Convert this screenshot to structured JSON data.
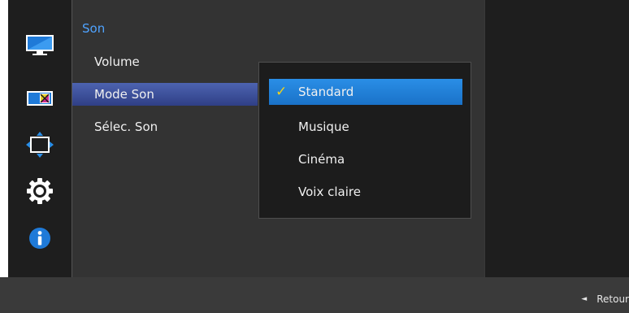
{
  "menu": {
    "title": "Son",
    "items": [
      {
        "label": "Volume",
        "selected": false
      },
      {
        "label": "Mode Son",
        "selected": true
      },
      {
        "label": "Sélec. Son",
        "selected": false
      }
    ]
  },
  "submenu": {
    "options": [
      {
        "label": "Standard",
        "selected": true
      },
      {
        "label": "Musique",
        "selected": false
      },
      {
        "label": "Cinéma",
        "selected": false
      },
      {
        "label": "Voix claire",
        "selected": false
      }
    ]
  },
  "sidebar": {
    "icons": [
      "picture-icon",
      "color-icon",
      "size-position-icon",
      "settings-gear-icon",
      "info-icon"
    ]
  },
  "footer": {
    "back_label": "Retour"
  },
  "colors": {
    "accent_blue": "#2a8ee6",
    "title_blue": "#4fa3ff",
    "check_yellow": "#f2d21a",
    "panel_dark": "#333333"
  }
}
